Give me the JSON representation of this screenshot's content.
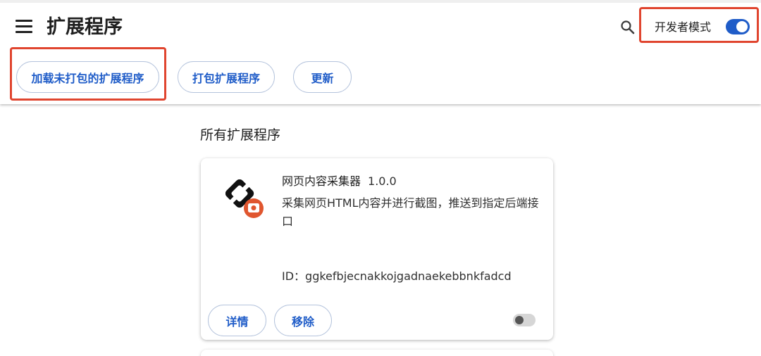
{
  "header": {
    "title": "扩展程序",
    "developer_mode_label": "开发者模式",
    "developer_mode_on": true,
    "menu_icon": "hamburger-menu-icon",
    "search_icon": "search-icon"
  },
  "toolbar": {
    "load_unpacked_label": "加载未打包的扩展程序",
    "pack_label": "打包扩展程序",
    "update_label": "更新"
  },
  "main": {
    "section_title": "所有扩展程序",
    "extensions": [
      {
        "name": "网页内容采集器",
        "version": "1.0.0",
        "description": "采集网页HTML内容并进行截图，推送到指定后端接口",
        "id_label": "ID：",
        "id": "ggkefbjecnakkojgadnaekebbnkfadcd",
        "details_label": "详情",
        "remove_label": "移除",
        "enabled": false
      }
    ]
  },
  "colors": {
    "accent": "#1f5cc8",
    "highlight": "#e0452f",
    "icon_badge": "#e0562f"
  }
}
